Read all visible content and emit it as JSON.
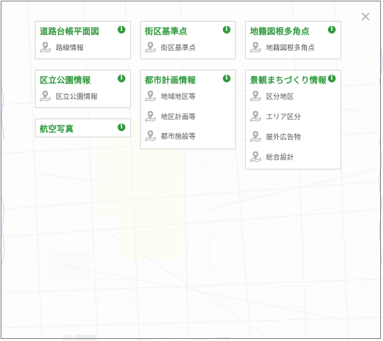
{
  "close_label": "✕",
  "cards": {
    "road": {
      "title": "道路台帳平面図",
      "items": [
        "路線情報"
      ]
    },
    "block": {
      "title": "街区基準点",
      "items": [
        "街区基準点"
      ]
    },
    "cadastral": {
      "title": "地籍図根多角点",
      "items": [
        "地籍図根多角点"
      ]
    },
    "park": {
      "title": "区立公園情報",
      "items": [
        "区立公園情報"
      ]
    },
    "photo": {
      "title": "航空写真",
      "items": []
    },
    "urban": {
      "title": "都市計画情報",
      "items": [
        "地域地区等",
        "地区計画等",
        "都市施設等"
      ]
    },
    "landscape": {
      "title": "景観まちづくり情報",
      "items": [
        "区分地区",
        "エリア区分",
        "屋外広告物",
        "総合設計"
      ]
    }
  },
  "info_glyph": "i",
  "colors": {
    "accent": "#2f9a3d",
    "item_text": "#555555",
    "icon_gray": "#9a9a9a"
  },
  "icons": {
    "item": "map-pin-icon",
    "info": "info-icon",
    "close": "close-icon"
  }
}
